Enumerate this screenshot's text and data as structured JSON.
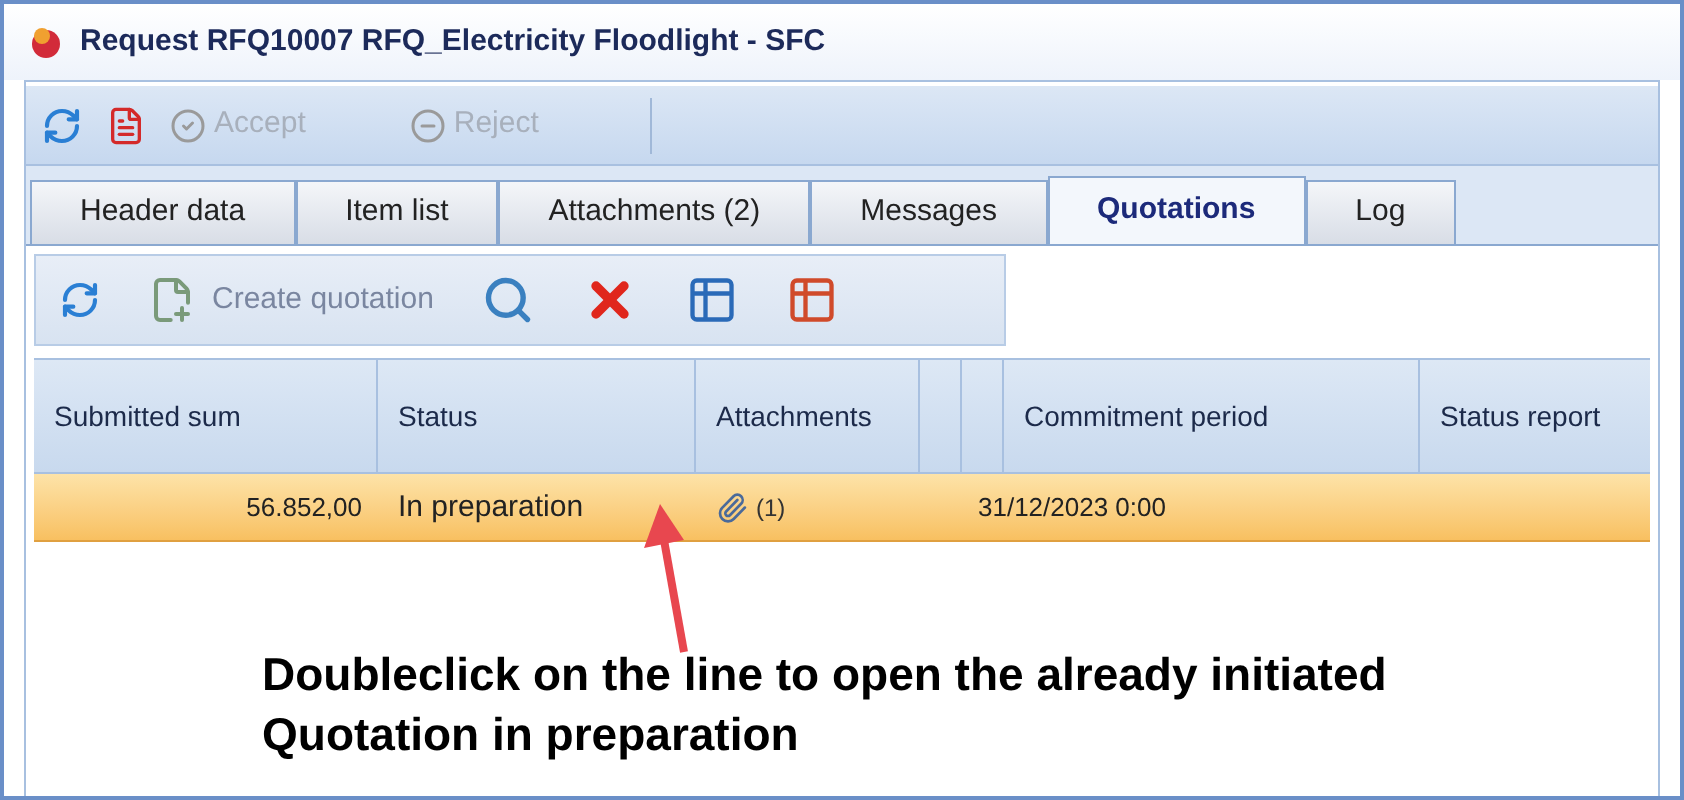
{
  "window": {
    "title": "Request RFQ10007 RFQ_Electricity Floodlight - SFC"
  },
  "toolbar": [
    {
      "kind": "refresh",
      "disabled": false
    },
    {
      "kind": "pdf",
      "disabled": false
    },
    {
      "kind": "accept",
      "label": "Accept",
      "disabled": true
    },
    {
      "kind": "reject",
      "label": "Reject",
      "disabled": true
    }
  ],
  "tabs": [
    {
      "label": "Header data",
      "selected": false
    },
    {
      "label": "Item list",
      "selected": false
    },
    {
      "label": "Attachments (2)",
      "selected": false
    },
    {
      "label": "Messages",
      "selected": false
    },
    {
      "label": "Quotations",
      "selected": true
    },
    {
      "label": "Log",
      "selected": false
    }
  ],
  "quotation_toolbar": [
    {
      "kind": "refresh"
    },
    {
      "kind": "create",
      "label": "Create quotation"
    },
    {
      "kind": "search"
    },
    {
      "kind": "delete"
    },
    {
      "kind": "export"
    },
    {
      "kind": "import"
    }
  ],
  "table": {
    "columns": [
      "Submitted sum",
      "Status",
      "Attachments",
      "",
      "",
      "Commitment period",
      "Status report"
    ],
    "rows": [
      {
        "selected": true,
        "submitted_sum": "56.852,00",
        "status": "In preparation",
        "attachments": "(1)",
        "commitment_period": "31/12/2023 0:00"
      }
    ]
  },
  "annotation": {
    "text": "Doubleclick on the line to open the already initiated Quotation in preparation"
  }
}
